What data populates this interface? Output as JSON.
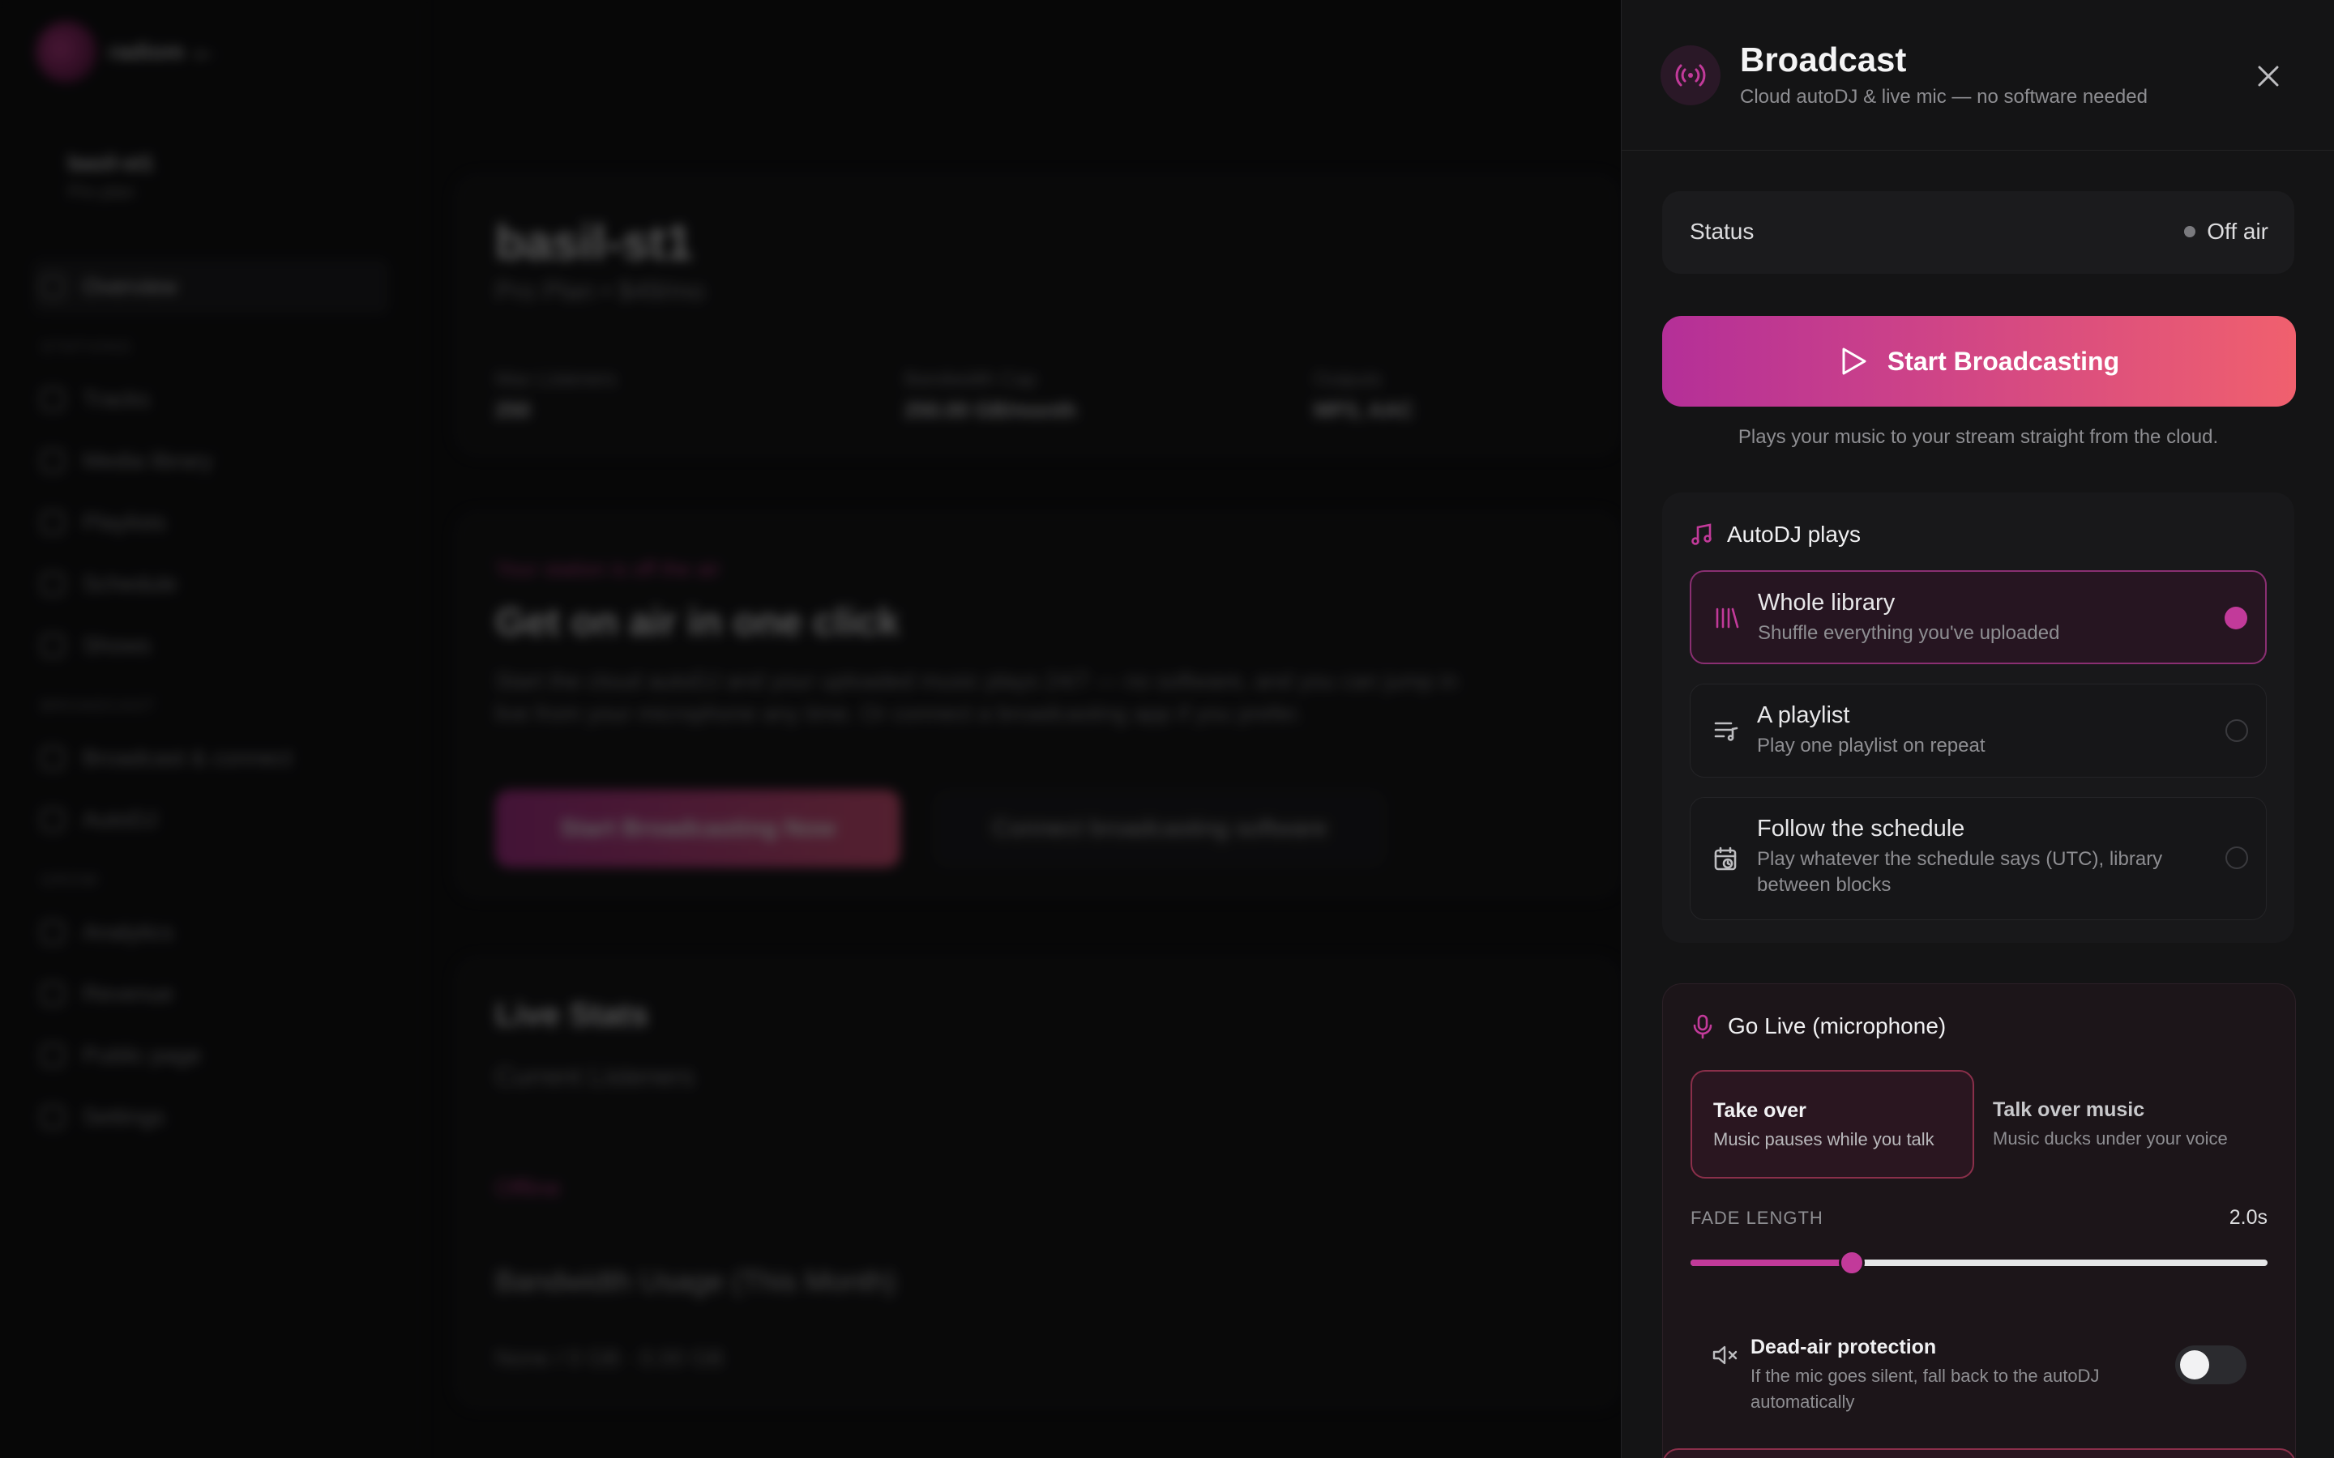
{
  "background": {
    "sidebar": {
      "logo_text": "radiom",
      "station_name": "basil-st1",
      "station_plan": "Pro plan",
      "items_main": [
        {
          "label": "Overview",
          "icon": "grid-icon"
        },
        {
          "label": "Tracks",
          "icon": "music-icon"
        },
        {
          "label": "Media library",
          "icon": "folder-icon"
        },
        {
          "label": "Playlists",
          "icon": "list-icon"
        },
        {
          "label": "Schedule",
          "icon": "calendar-icon"
        },
        {
          "label": "Shows",
          "icon": "mic-icon"
        }
      ],
      "section_broadcast": "Broadcast",
      "items_broadcast": [
        {
          "label": "Broadcast & connect",
          "icon": "radio-icon"
        },
        {
          "label": "AutoDJ",
          "icon": "shuffle-icon"
        }
      ],
      "section_grow": "Grow",
      "items_grow": [
        {
          "label": "Analytics",
          "icon": "chart-icon"
        },
        {
          "label": "Revenue",
          "icon": "dollar-icon"
        },
        {
          "label": "Public page",
          "icon": "link-icon"
        },
        {
          "label": "Settings",
          "icon": "gear-icon"
        }
      ],
      "section_stations": "Stations"
    },
    "station_card": {
      "title": "basil-st1",
      "subtitle": "Pro Plan • $49/mo",
      "stats": [
        {
          "k": "Max Listeners",
          "v": "250"
        },
        {
          "k": "Bandwidth Cap",
          "v": "250.00 GB/month"
        },
        {
          "k": "Outputs",
          "v": "MP3, AAC"
        }
      ]
    },
    "onair_card": {
      "eyebrow": "Your station is off the air",
      "title": "Get on air in one click",
      "desc": "Start the cloud autoDJ and your uploaded music plays 24/7 — no software, and you can jump in live from your microphone any time. Or connect a broadcasting app if you prefer.",
      "primary": "Start Broadcasting Now",
      "secondary": "Connect broadcasting software"
    },
    "stats_card": {
      "title": "Live Stats",
      "line1": "Current Listeners",
      "status": "Offline",
      "line2": "Bandwidth Usage (This Month)",
      "line3": "None / 0 GB · 0.00 GB"
    }
  },
  "drawer": {
    "title": "Broadcast",
    "subtitle": "Cloud autoDJ & live mic — no software needed",
    "status_label": "Status",
    "status_value": "Off air",
    "start_button": "Start Broadcasting",
    "start_hint": "Plays your music to your stream straight from the cloud.",
    "autodj": {
      "title": "AutoDJ plays",
      "options": [
        {
          "title": "Whole library",
          "subtitle": "Shuffle everything you've uploaded",
          "selected": true,
          "icon": "library-icon"
        },
        {
          "title": "A playlist",
          "subtitle": "Play one playlist on repeat",
          "selected": false,
          "icon": "playlist-icon"
        },
        {
          "title": "Follow the schedule",
          "subtitle": "Play whatever the schedule says (UTC), library between blocks",
          "selected": false,
          "icon": "calendar-clock-icon"
        }
      ]
    },
    "live": {
      "title": "Go Live (microphone)",
      "modes": [
        {
          "title": "Take over",
          "subtitle": "Music pauses while you talk",
          "selected": true
        },
        {
          "title": "Talk over music",
          "subtitle": "Music ducks under your voice",
          "selected": false
        }
      ],
      "fade_label": "FADE LENGTH",
      "fade_value": "2.0s",
      "fade_fraction": 0.28,
      "deadair_title": "Dead-air protection",
      "deadair_sub": "If the mic goes silent, fall back to the autoDJ automatically",
      "deadair_enabled": false
    },
    "colors": {
      "accent": "#c23a9a",
      "gradient_start": "#b42f98",
      "gradient_end": "#f0606e"
    }
  }
}
